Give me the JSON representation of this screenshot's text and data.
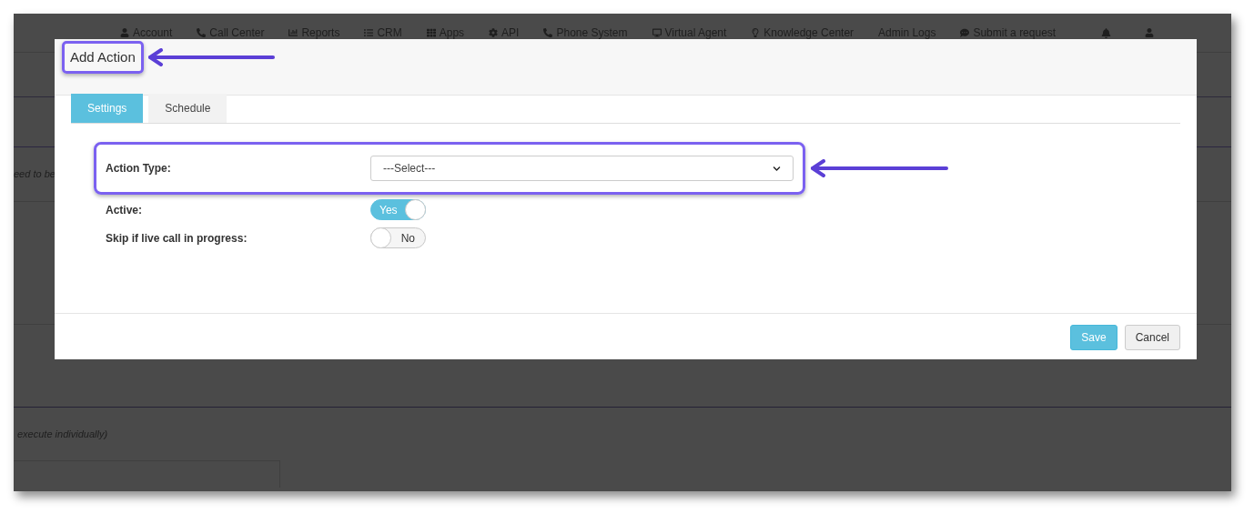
{
  "nav": [
    {
      "label": "Account"
    },
    {
      "label": "Call Center"
    },
    {
      "label": "Reports"
    },
    {
      "label": "CRM"
    },
    {
      "label": "Apps"
    },
    {
      "label": "API"
    },
    {
      "label": "Phone System"
    },
    {
      "label": "Virtual Agent"
    },
    {
      "label": "Knowledge Center"
    },
    {
      "label": "Admin Logs"
    },
    {
      "label": "Submit a request"
    }
  ],
  "background": {
    "note_1": "eed to be",
    "note_2": "execute individually)"
  },
  "modal": {
    "title": "Add Action",
    "tabs": [
      {
        "label": "Settings",
        "selected": true
      },
      {
        "label": "Schedule",
        "selected": false
      }
    ],
    "fields": [
      {
        "kind": "select",
        "label": "Action Type:",
        "value": "---Select---",
        "highlighted": true
      },
      {
        "kind": "toggle",
        "label": "Active:",
        "on": true,
        "value_label": "Yes",
        "highlighted": false
      },
      {
        "kind": "toggle",
        "label": "Skip if live call in progress:",
        "on": false,
        "value_label": "No",
        "highlighted": false
      }
    ],
    "buttons": [
      {
        "label": "Save",
        "kind": "primary"
      },
      {
        "label": "Cancel",
        "kind": "default"
      }
    ]
  },
  "annotations": {
    "title_highlighted": true
  }
}
